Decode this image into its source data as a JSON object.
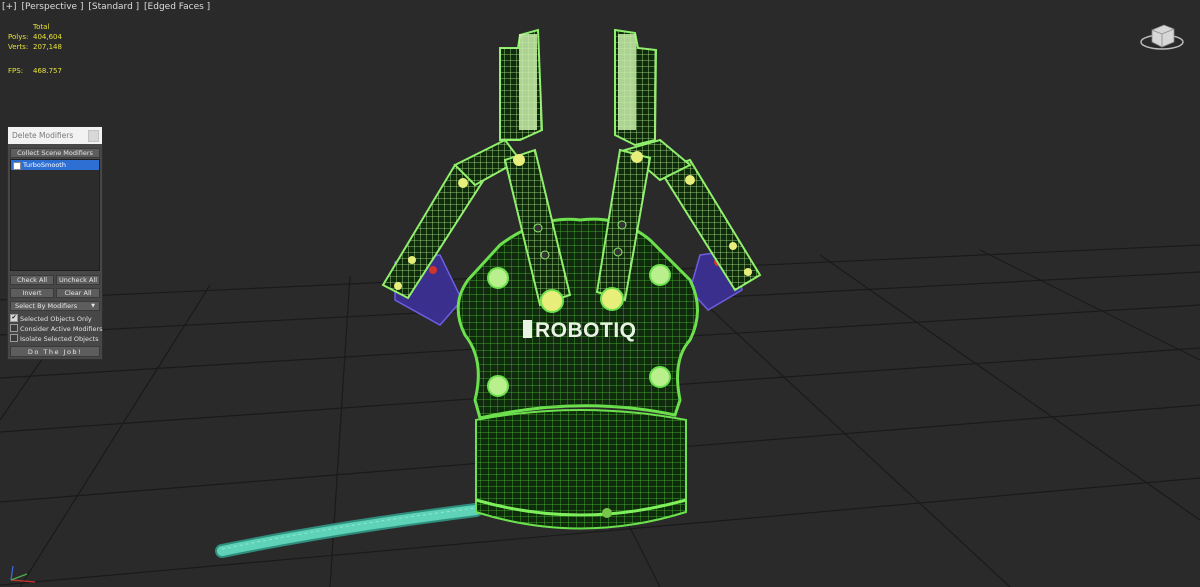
{
  "viewport": {
    "label_parts": [
      "[+]",
      "[Perspective ]",
      "[Standard ]",
      "[Edged Faces ]"
    ],
    "stats": {
      "header": "Total",
      "polys_label": "Polys:",
      "polys_value": "404,604",
      "verts_label": "Verts:",
      "verts_value": "207,148",
      "fps_label": "FPS:",
      "fps_value": "468.757"
    },
    "logo_text": "ROBOTIQ",
    "colors": {
      "background": "#2a2a2a",
      "grid": "#1c1c1c",
      "wireframe_green": "#79e85a",
      "wireframe_light": "#b4f08f",
      "cable": "#5fd3b8",
      "joint_yellow": "#e8ee7a",
      "joint_red": "#d1332d",
      "purple_part": "#4d3db0",
      "stats_text": "#e6e23a"
    }
  },
  "panel": {
    "title": "Delete Modifiers",
    "collect_button": "Collect Scene Modifiers",
    "modifiers": [
      {
        "label": "TurboSmooth",
        "selected": true,
        "checked": false
      }
    ],
    "check_all": "Check All",
    "uncheck_all": "Uncheck All",
    "invert": "Invert",
    "clear_all": "Clear All",
    "select_by": "Select By Modifiers",
    "selected_only": "Selected Objects Only",
    "consider_active": "Consider Active Modifiers",
    "isolate_selected": "Isolate Selected Objects",
    "do_the_job": "Do The Job!"
  }
}
